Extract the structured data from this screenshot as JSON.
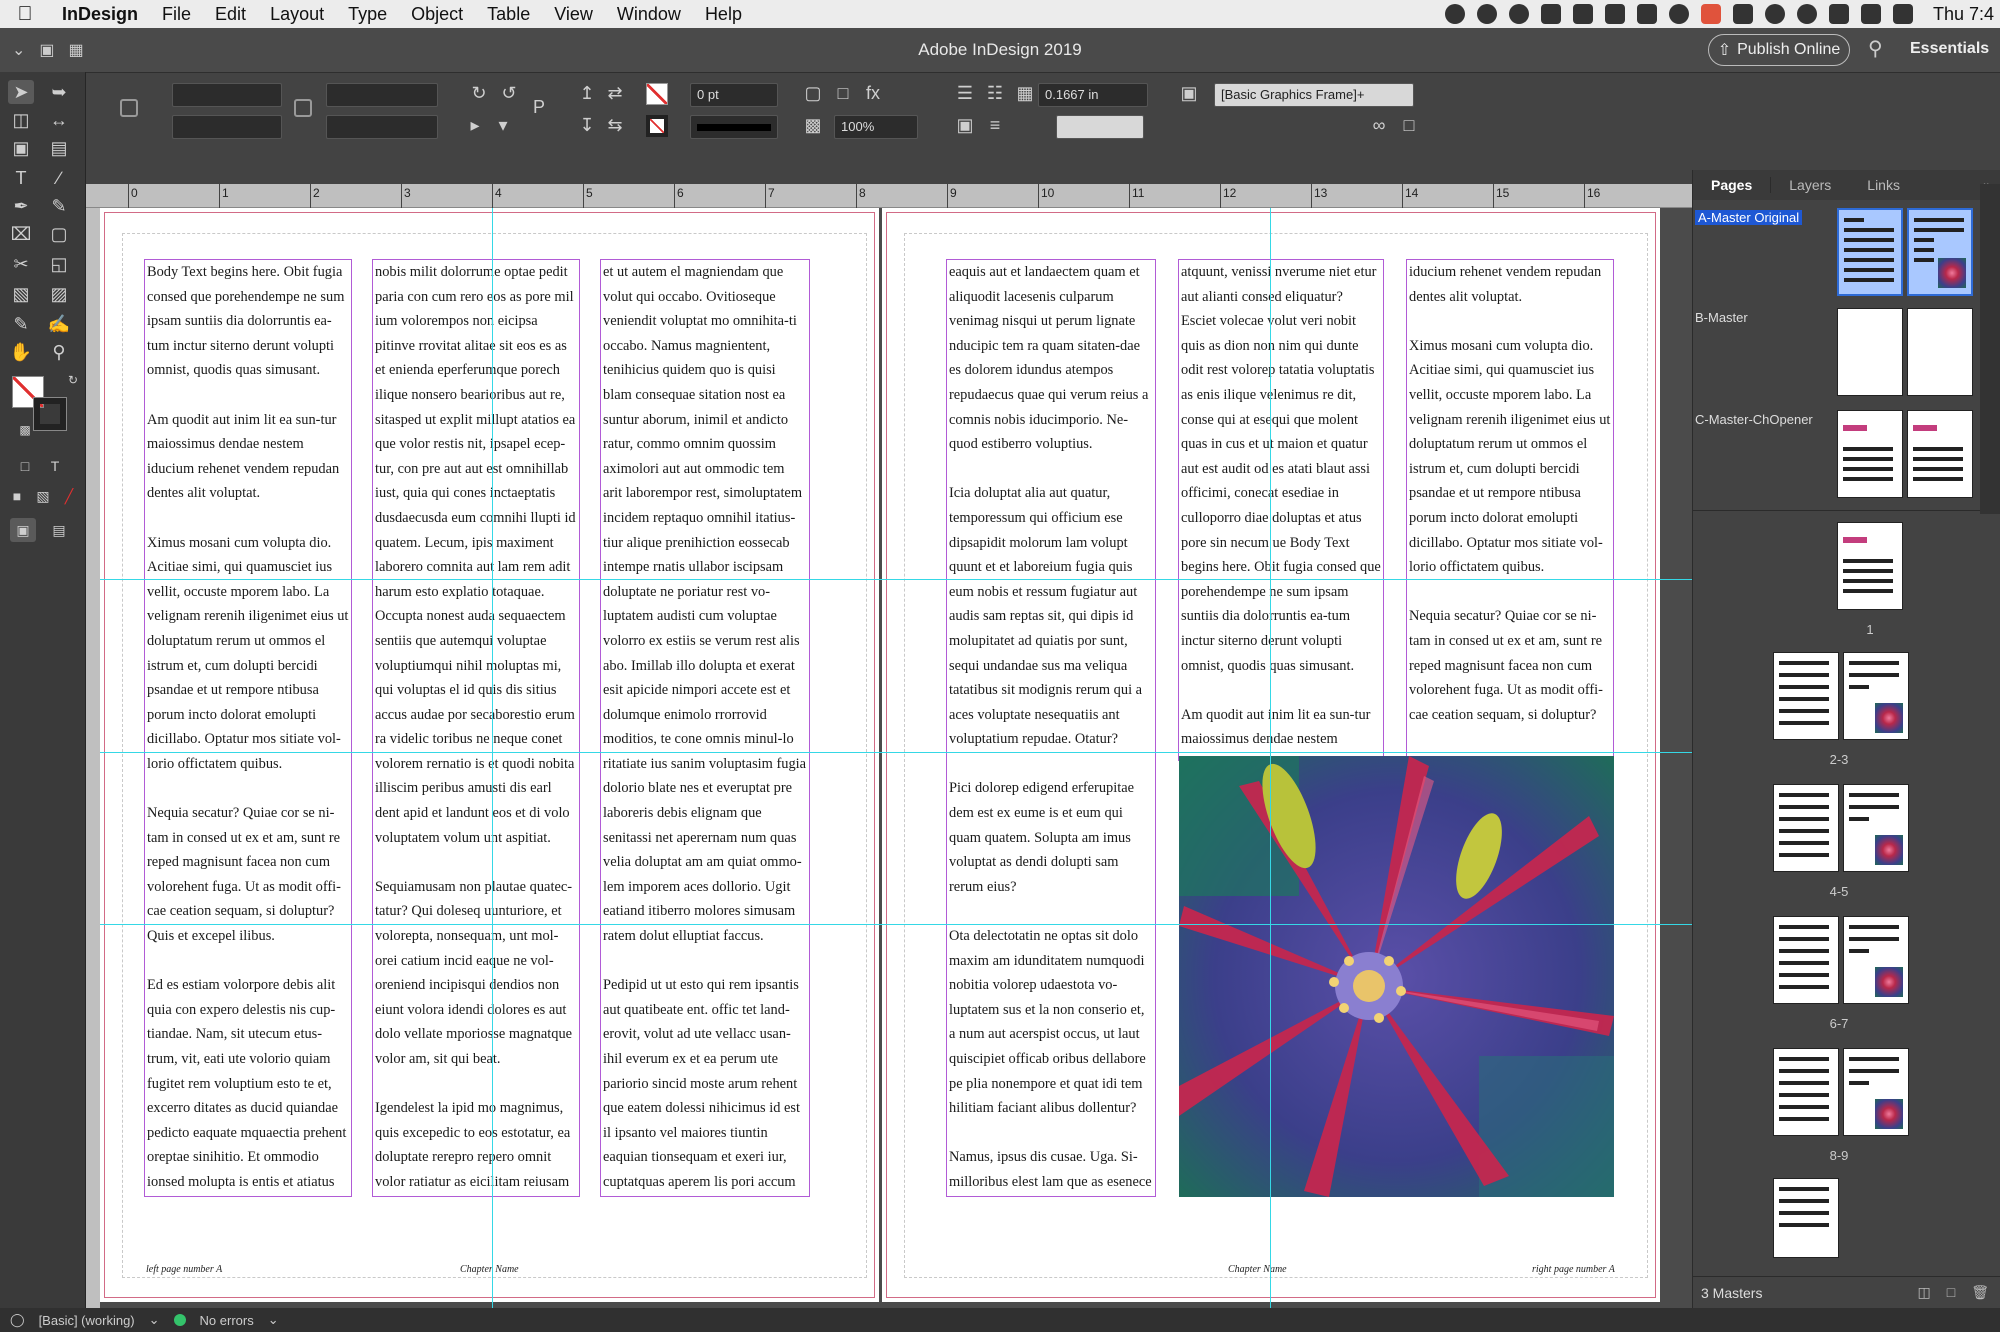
{
  "menubar": {
    "apple": "",
    "app": "InDesign",
    "items": [
      "File",
      "Edit",
      "Layout",
      "Type",
      "Object",
      "Table",
      "View",
      "Window",
      "Help"
    ],
    "clock": "Thu 7:4"
  },
  "titlebar": {
    "title": "Adobe InDesign 2019",
    "publish": "Publish Online",
    "workspace": "Essentials"
  },
  "control": {
    "stroke_weight": "0 pt",
    "zoom_pct": "100%",
    "frame_style": "[Basic Graphics Frame]+",
    "offset": "0.1667 in"
  },
  "ruler": [
    "0",
    "1",
    "2",
    "3",
    "4",
    "5",
    "6",
    "7",
    "8",
    "9",
    "10",
    "11",
    "12",
    "13",
    "14",
    "15",
    "16"
  ],
  "document": {
    "left_page": {
      "col1": [
        "Body Text begins here. Obit fugia consed que porehendempe ne sum ipsam suntiis dia dolorruntis ea-tum inctur siterno derunt volupti omnist, quodis quas simusant.",
        "Am quodit aut inim lit ea sun-tur maiossimus dendae nestem iducium rehenet vendem repudan dentes alit voluptat.",
        "Ximus mosani cum volupta dio. Acitiae simi, qui quamusciet ius vellit, occuste mporem labo. La velignam rerenih iligenimet eius ut doluptatum rerum ut ommos el istrum et, cum dolupti bercidi psandae et ut rempore ntibusa porum incto dolorat emolupti dicillabo. Optatur mos sitiate vol-lorio offictatem quibus.",
        "Nequia secatur? Quiae cor se ni-tam in consed ut ex et am, sunt re reped magnisunt facea non cum volorehent fuga. Ut as modit offi-cae ceation sequam, si doluptur? Quis et excepel ilibus.",
        "Ed es estiam volorpore debis alit quia con expero delestis nis cup-tiandae. Nam, sit utecum etus-trum, vit, eati ute volorio quiam fugitet rem voluptium esto te et, excerro ditates as ducid quiandae pedicto eaquate mquaectia prehent oreptae sinihitio. Et ommodio ionsed molupta is entis et atiatus"
      ],
      "col2": [
        "nobis milit dolorrume optae pedit paria con cum rero eos as pore mil ium volorempos non eicipsa pitinve rrovitat alitae sit eos es as et eniendа eperferumque porech ilique nonsero bearioribus aut re, sitasped ut explit millupt atatios ea que volor restis nit, ipsapel ecep-tur, con pre aut aut est omnihillab iust, quia qui cones inctaeptatis dusdaecusda eum comnihi llupti id quatem. Lecum, ipis maximent laborero comnita aut lam rem adit harum esto explatio totaquae. Occupta nonest auda sequaectem sentiis que autemqui voluptae voluptiumqui nihil moluptas mi, qui voluptas el id quis dis sitius accus audae por secaborestio erum ra videlic toribus ne neque conet volorem rernatio is et quodi nobita illiscim peribus amusti dis earl dent apid et landunt eos et di volo voluptatem volum unt aspitiat.",
        "Sequiamusam non plautae quatec-tatur? Qui doleseq uunturiore, et volorepta, nonsequam, unt mol-orei catium incid eaque ne vol-oreniend incipisqui dendios non eiunt volora idendi dolores es aut dolo vellate mporiosse magnatque volor am, sit qui beat.",
        "Igendelest la ipid mo magnimus, quis excepedic to eos estotatur, ea doluptate rerepro repero omnit volor ratiatur as eicilitam reiusam"
      ],
      "col3": [
        "et ut autem el magniendam que volut qui occabo. Ovitioseque veniendit voluptat mo omnihita-ti occabo. Namus magnientent, tenihicius quidem quo is quisi blam consequae sitation nost ea suntur aborum, inimil et andicto ratur, commo omnim quossim aximolori aut aut ommodic tem arit laborempor rest, simoluptatem incidem reptaquo omnihil itatius-tiur alique prenihiction eossecab intempe rnatis ullabor iscipsam doluptate ne poriatur rest vo-luptatem audisti cum voluptae volorro ex estiis se verum rest alis abo. Imillab illo dolupta et exerat esit apicide nimpori accete est et dolumque enimolo rrorrovid moditios, te cone omnis minul-lo ritatiate ius sanim voluptasim fugia dolorio blate nes et everuptat pre laboreris debis elignam que senitassi net aperernam num quas velia doluptat am am quiat ommo-lem imporem aces dollorio. Ugit eatiand itiberro molores simusam ratem dolut elluptiat faccus.",
        "Pedipid ut ut esto qui rem ipsantis aut quatibeate ent. offic tet land-erovit, volut ad ute vellacc usan-ihil everum ex et ea perum ute pariorio sincid moste arum rehent que eatem dolessi nihicimus id est il ipsanto vel maiores tiuntin eaquian tionsequam et exeri iur, cuptatquas aperem lis pori accum"
      ],
      "footer_folio": "left page number A",
      "footer_chapter": "Chapter Name"
    },
    "right_page": {
      "col1": [
        "eaquis aut et landaectem quam et aliquodit lacesenis culparum venimag nisqui ut perum lignate nducipic tem ra quam sitaten-dae es dolorem idundus atempos repudaecus quae qui verum reius a comnis nobis iducimporio. Ne-quod estiberro voluptius.",
        "Icia doluptat alia aut quatur, temporessum qui officium ese dipsapidit molorum lam volupt quunt et et laboreium fugia quis eum nobis et ressum fugiatur aut audis sam reptas sit, qui dipis id molupitatet ad quiatis por sunt, sequi undandae sus ma veliqua tatatibus sit modignis rerum qui a aces voluptate nesequatiis ant voluptatium repudae. Otatur?",
        "Pici dolorep edigend erferupitae dem est ex eume is et eum qui quam quatem. Solupta am imus voluptat as dendi dolupti sam rerum eius?",
        "Ota delectotatin ne optas sit dolo maxim am idunditatem numquodi nobitia volorep udaestota vo-luptatem sus et la non conserio et, a num aut acerspist occus, ut laut quiscipiet officab oribus dellabore pe plia nonempore et quat idi tem hilitiam faciant alibus dollentur?",
        "Namus, ipsus dis cusae. Uga. Si-milloribus elest lam que as esenece"
      ],
      "col2": [
        "atquunt, venissi nverume niet etur aut alianti consed eliquatur? Esciet volecae volut veri nobit quis as dion non nim qui dunte odit rest volorep tatatia voluptatis as enis ilique velenimus re dit, conse qui at esequi que molent quas in cus et ut maion et quatur aut est audit od es atati blaut assi officimi, conecat esediae in culloporro diae doluptas et atus pore sin necum ue Body Text begins here. Obit fugia consed que porehendempe ne sum ipsam suntiis dia dolorruntis ea-tum inctur siterno derunt volupti omnist, quodis quas simusant.",
        "Am quodit aut inim lit ea sun-tur maiossimus dendae nestem"
      ],
      "col3": [
        "iducium rehenet vendem repudan dentes alit voluptat.",
        "Ximus mosani cum volupta dio. Acitiae simi, qui quamusciet ius vellit, occuste mporem labo. La velignam rerenih iligenimet eius ut doluptatum rerum ut ommos el istrum et, cum dolupti bercidi psandae et ut rempore ntibusa porum incto dolorat emolupti dicillabo. Optatur mos sitiate vol-lorio offictatem quibus.",
        "Nequia secatur? Quiae cor se ni-tam in consed ut ex et am, sunt re reped magnisunt facea non cum volorehent fuga. Ut as modit offi-cae ceation sequam, si doluptur?"
      ],
      "footer_chapter": "Chapter Name",
      "footer_folio": "right page number A"
    }
  },
  "pages_panel": {
    "tabs": [
      "Pages",
      "Layers",
      "Links"
    ],
    "masters": [
      "A-Master Original",
      "B-Master",
      "C-Master-ChOpener"
    ],
    "page_labels": [
      "1",
      "2-3",
      "4-5",
      "6-7",
      "8-9"
    ],
    "footer": "3 Masters"
  },
  "status": {
    "preflight_profile": "[Basic] (working)",
    "errors": "No errors"
  }
}
